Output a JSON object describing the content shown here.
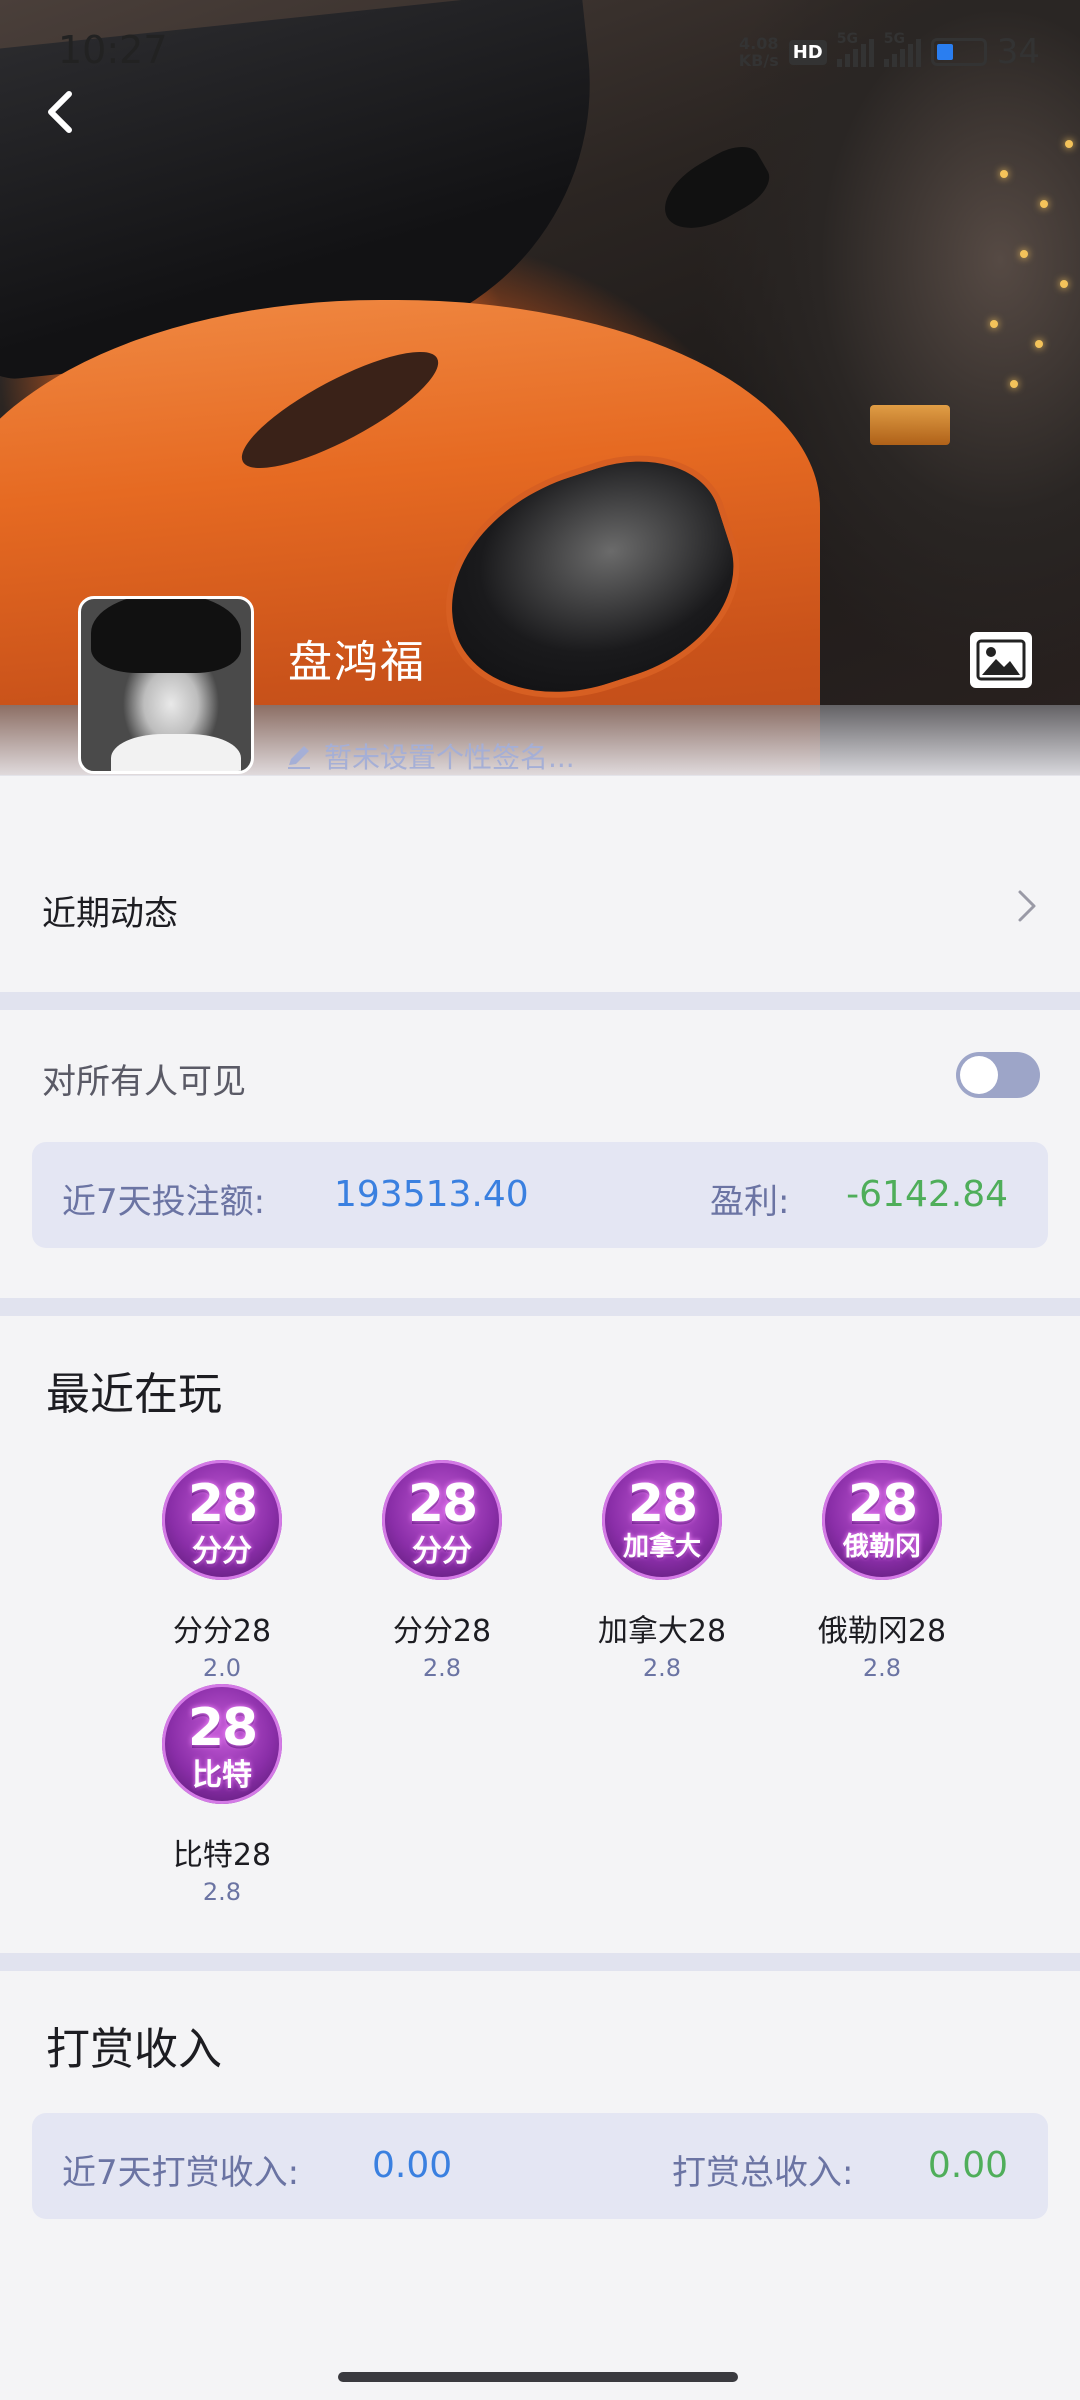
{
  "status_bar": {
    "time": "10:27",
    "net_speed": "4.08",
    "net_unit": "KB/s",
    "hd_badge": "HD",
    "signal1_tag": "5G",
    "signal2_tag": "5G",
    "battery_percent": "34"
  },
  "profile": {
    "username": "盘鸿福",
    "signature_placeholder": "暂未设置个性签名..."
  },
  "recent_activity": {
    "label": "近期动态"
  },
  "visibility": {
    "label": "对所有人可见",
    "toggle_on": false,
    "stats": {
      "bet_label": "近7天投注额:",
      "bet_value": "193513.40",
      "profit_label": "盈利:",
      "profit_value": "-6142.84"
    }
  },
  "playing": {
    "title": "最近在玩",
    "games": [
      {
        "icon_top": "28",
        "icon_sub": "分分",
        "name": "分分28",
        "odds": "2.0"
      },
      {
        "icon_top": "28",
        "icon_sub": "分分",
        "name": "分分28",
        "odds": "2.8"
      },
      {
        "icon_top": "28",
        "icon_sub": "加拿大",
        "name": "加拿大28",
        "odds": "2.8"
      },
      {
        "icon_top": "28",
        "icon_sub": "俄勒冈",
        "name": "俄勒冈28",
        "odds": "2.8"
      },
      {
        "icon_top": "28",
        "icon_sub": "比特",
        "name": "比特28",
        "odds": "2.8"
      }
    ]
  },
  "tips": {
    "title": "打赏收入",
    "week_label": "近7天打赏收入:",
    "week_value": "0.00",
    "total_label": "打赏总收入:",
    "total_value": "0.00"
  },
  "colors": {
    "accent_blue": "#3a80e0",
    "profit_green": "#4fae5a",
    "card_bg": "#e4e6f3",
    "muted_label": "#6b74a3"
  },
  "icons": {
    "back": "chevron-left-icon",
    "cover": "image-icon",
    "signature": "pencil-icon",
    "recent": "chevron-right-icon"
  }
}
